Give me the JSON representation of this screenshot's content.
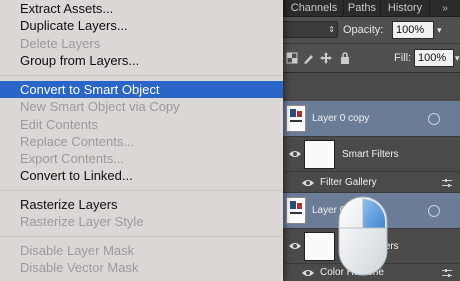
{
  "menu": {
    "items": [
      {
        "label": "Extract Assets...",
        "disabled": false
      },
      {
        "label": "Duplicate Layers...",
        "disabled": false
      },
      {
        "label": "Delete Layers",
        "disabled": true
      },
      {
        "label": "Group from Layers...",
        "disabled": false
      },
      {
        "label": "Convert to Smart Object",
        "disabled": false,
        "highlighted": true
      },
      {
        "label": "New Smart Object via Copy",
        "disabled": true
      },
      {
        "label": "Edit Contents",
        "disabled": true
      },
      {
        "label": "Replace Contents...",
        "disabled": true
      },
      {
        "label": "Export Contents...",
        "disabled": true
      },
      {
        "label": "Convert to Linked...",
        "disabled": false
      },
      {
        "label": "Rasterize Layers",
        "disabled": false
      },
      {
        "label": "Rasterize Layer Style",
        "disabled": true
      },
      {
        "label": "Disable Layer Mask",
        "disabled": true
      },
      {
        "label": "Disable Vector Mask",
        "disabled": true
      }
    ],
    "highlight_color": "#2a65c9"
  },
  "panel": {
    "tabs": [
      "Channels",
      "Paths",
      "History"
    ],
    "opacity_label": "Opacity:",
    "opacity_value": "100%",
    "fill_label": "Fill:",
    "fill_value": "100%",
    "layers": [
      {
        "name": "Layer 0 copy",
        "selected": true
      },
      {
        "name": "Smart Filters"
      },
      {
        "name": "Filter Gallery"
      },
      {
        "name": "Layer 0",
        "selected": true
      },
      {
        "name": "Smart Filters"
      },
      {
        "name": "Color Halftone"
      }
    ],
    "selected_color": "#6b7c96"
  }
}
